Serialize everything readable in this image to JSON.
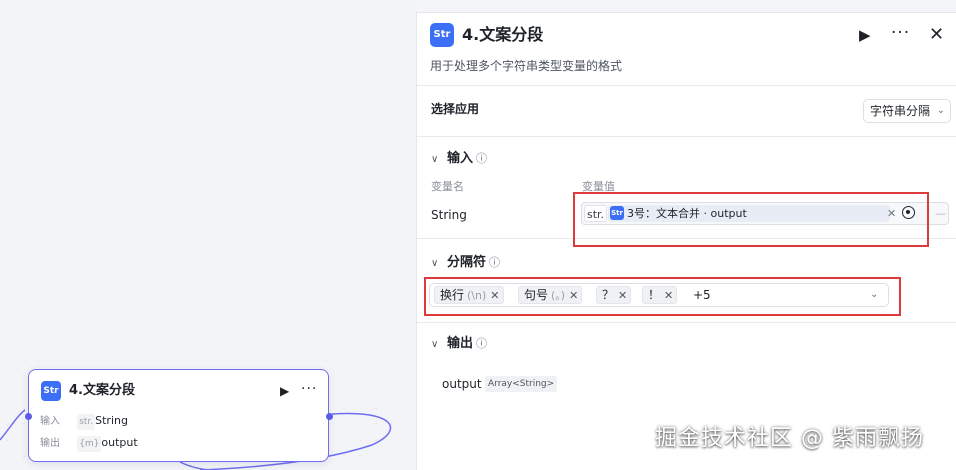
{
  "canvas_node": {
    "title": "4.文案分段",
    "input_label": "输入",
    "input_prefix": "str.",
    "input_value": "String",
    "output_label": "输出",
    "output_prefix": "{m}",
    "output_value": "output"
  },
  "panel": {
    "icon_text": "Str",
    "title": "4.文案分段",
    "description": "用于处理多个字符串类型变量的格式",
    "select_app_label": "选择应用",
    "select_app_value": "字符串分隔",
    "input_section": {
      "title": "输入",
      "col_name": "变量名",
      "col_value": "变量值",
      "var_name": "String",
      "type_prefix": "str.",
      "ref_node": "3号：文本合并",
      "ref_sep": "·",
      "ref_field": "output",
      "row_dash": "—"
    },
    "separator_section": {
      "title": "分隔符",
      "tags": [
        {
          "label": "换行",
          "escape": "(\\n)"
        },
        {
          "label": "句号",
          "escape": "(。)"
        },
        {
          "label": "？",
          "escape": ""
        },
        {
          "label": "！",
          "escape": ""
        }
      ],
      "more": "+5"
    },
    "output_section": {
      "title": "输出",
      "var_name": "output",
      "var_type": "Array<String>"
    }
  },
  "icons": {
    "play": "▶",
    "more": "···",
    "close": "✕",
    "chevron_down": "⌄",
    "chevron_collapse": "∨",
    "info": "ⓘ",
    "remove": "✕"
  },
  "colors": {
    "accent": "#3b6ff6",
    "node_border": "#6e6ef0",
    "highlight": "#e0393b"
  },
  "watermark": "掘金技术社区 @ 紫雨飘扬"
}
